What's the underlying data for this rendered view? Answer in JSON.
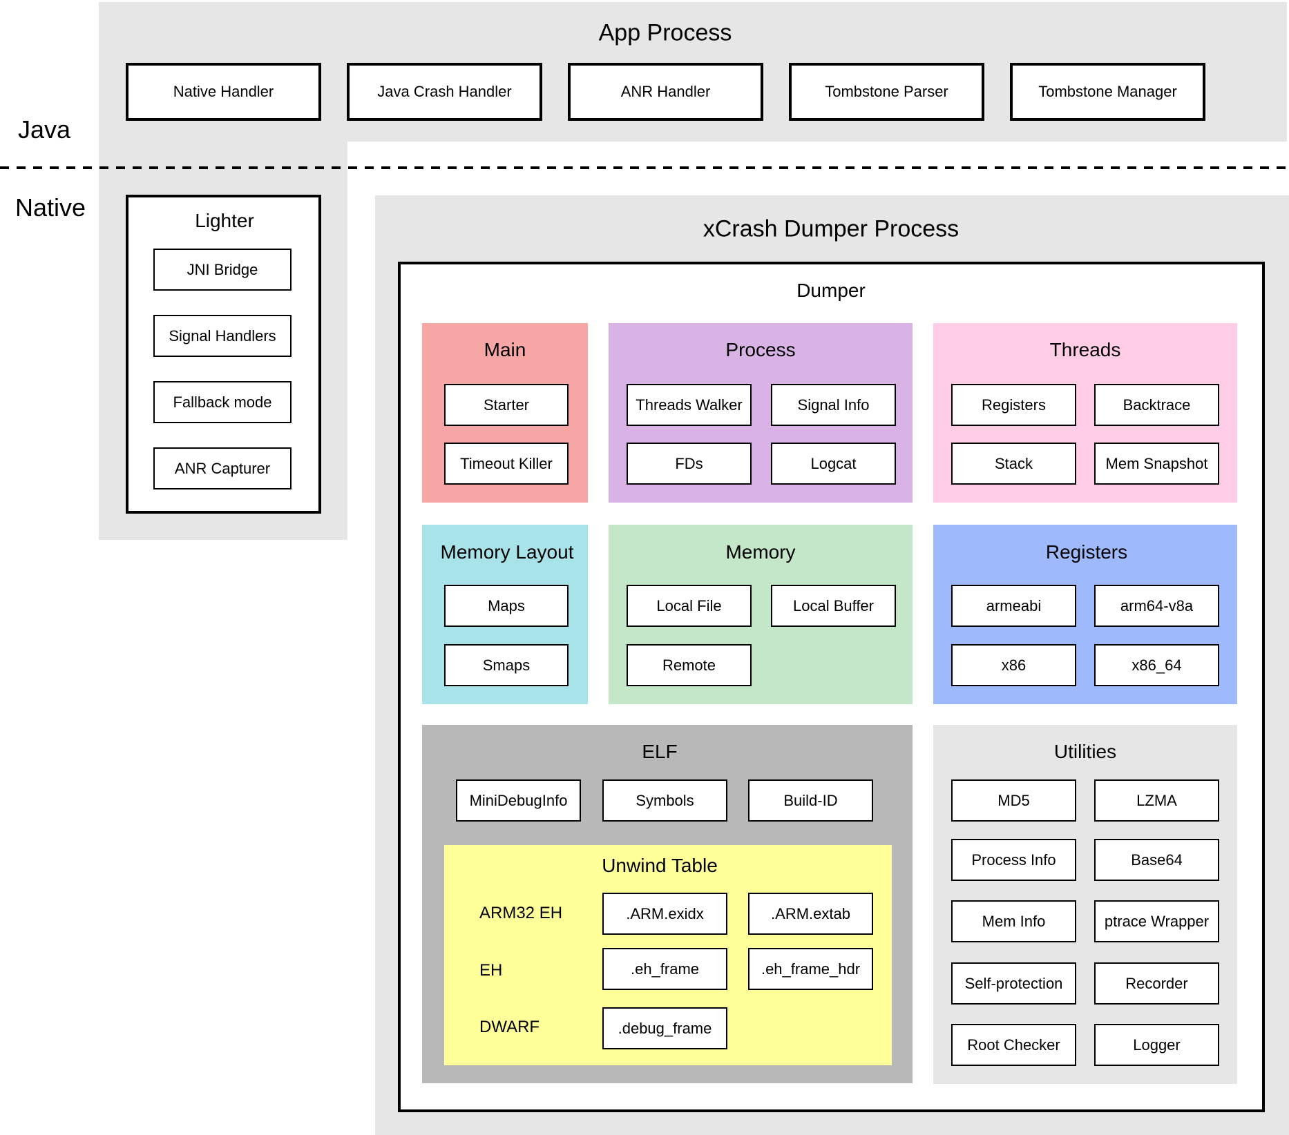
{
  "layers": {
    "java": "Java",
    "native": "Native"
  },
  "app_process": {
    "title": "App Process",
    "components": [
      "Native Handler",
      "Java Crash Handler",
      "ANR Handler",
      "Tombstone Parser",
      "Tombstone Manager"
    ]
  },
  "lighter": {
    "title": "Lighter",
    "components": [
      "JNI Bridge",
      "Signal Handlers",
      "Fallback mode",
      "ANR Capturer"
    ]
  },
  "dumper_process": {
    "title": "xCrash Dumper Process",
    "dumper": {
      "title": "Dumper",
      "main": {
        "title": "Main",
        "color": "#F6A6A4",
        "items": [
          "Starter",
          "Timeout Killer"
        ]
      },
      "process": {
        "title": "Process",
        "color": "#D9B3E6",
        "items": [
          "Threads Walker",
          "Signal Info",
          "FDs",
          "Logcat"
        ]
      },
      "threads": {
        "title": "Threads",
        "color": "#FFCCE6",
        "items": [
          "Registers",
          "Backtrace",
          "Stack",
          "Mem Snapshot"
        ]
      },
      "memory_layout": {
        "title": "Memory Layout",
        "color": "#A9E3EA",
        "items": [
          "Maps",
          "Smaps"
        ]
      },
      "memory": {
        "title": "Memory",
        "color": "#C4E7C9",
        "items": [
          "Local File",
          "Local Buffer",
          "Remote"
        ]
      },
      "registers": {
        "title": "Registers",
        "color": "#9EBAFD",
        "items": [
          "armeabi",
          "arm64-v8a",
          "x86",
          "x86_64"
        ]
      },
      "elf": {
        "title": "ELF",
        "color": "#B8B8B8",
        "items": [
          "MiniDebugInfo",
          "Symbols",
          "Build-ID"
        ],
        "unwind_table": {
          "title": "Unwind Table",
          "color": "#FFFF99",
          "rows": [
            {
              "label": "ARM32 EH",
              "items": [
                ".ARM.exidx",
                ".ARM.extab"
              ]
            },
            {
              "label": "EH",
              "items": [
                ".eh_frame",
                ".eh_frame_hdr"
              ]
            },
            {
              "label": "DWARF",
              "items": [
                ".debug_frame"
              ]
            }
          ]
        }
      },
      "utilities": {
        "title": "Utilities",
        "color": "#E6E6E6",
        "items": [
          "MD5",
          "LZMA",
          "Process Info",
          "Base64",
          "Mem Info",
          "ptrace Wrapper",
          "Self-protection",
          "Recorder",
          "Root Checker",
          "Logger"
        ]
      }
    }
  }
}
